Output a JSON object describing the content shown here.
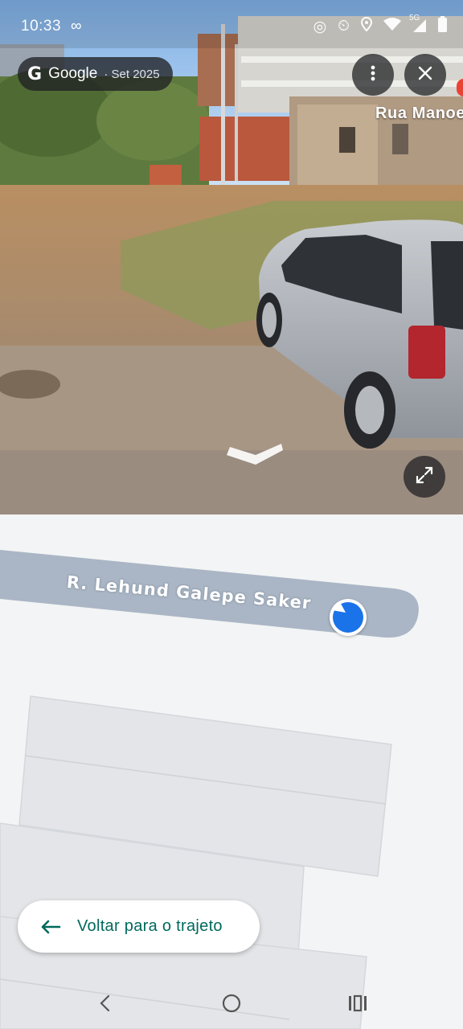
{
  "status_bar": {
    "time": "10:33",
    "left_icons": [
      "infinity-icon"
    ],
    "right_icons": [
      "sync-icon",
      "alarm-icon",
      "location-icon",
      "wifi-icon",
      "5g-signal-icon",
      "battery-icon"
    ],
    "network": "5G"
  },
  "street_view": {
    "source_chip": {
      "brand": "Google",
      "date": "· Set 2025"
    },
    "more_icon": "more-vert-icon",
    "close_icon": "close-icon",
    "expand_icon": "expand-icon",
    "street_name": "Rua Manoe"
  },
  "map": {
    "road_label": "R. Lehund Galepe Saker",
    "location_marker_icon": "navigation-arrow-icon"
  },
  "back_button": {
    "label": "Voltar para o trajeto",
    "icon": "arrow-back-icon"
  },
  "navigation_bar": {
    "buttons": [
      "back-nav-icon",
      "home-nav-icon",
      "recents-nav-icon"
    ]
  },
  "colors": {
    "accent_teal": "#00695c",
    "marker_blue": "#1a73e8",
    "road": "#aab6c5",
    "map_bg": "#f3f4f5"
  }
}
